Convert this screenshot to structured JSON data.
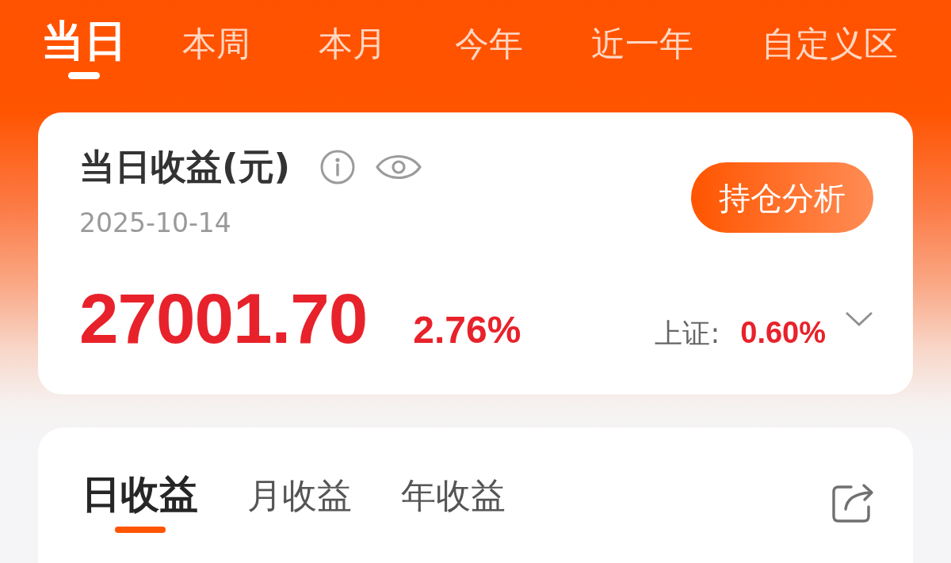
{
  "period_tabs": [
    {
      "label": "当日",
      "selected": true
    },
    {
      "label": "本周",
      "selected": false
    },
    {
      "label": "本月",
      "selected": false
    },
    {
      "label": "今年",
      "selected": false
    },
    {
      "label": "近一年",
      "selected": false
    },
    {
      "label": "自定义区",
      "selected": false
    }
  ],
  "summary_card": {
    "title": "当日收益(元)",
    "date": "2025-10-14",
    "amount": "27001.70",
    "rate": "2.76%",
    "button": "持仓分析",
    "index": {
      "label": "上证:",
      "change": "0.60%"
    }
  },
  "earnings_card": {
    "tabs": [
      {
        "label": "日收益",
        "selected": true
      },
      {
        "label": "月收益",
        "selected": false
      },
      {
        "label": "年收益",
        "selected": false
      }
    ]
  }
}
